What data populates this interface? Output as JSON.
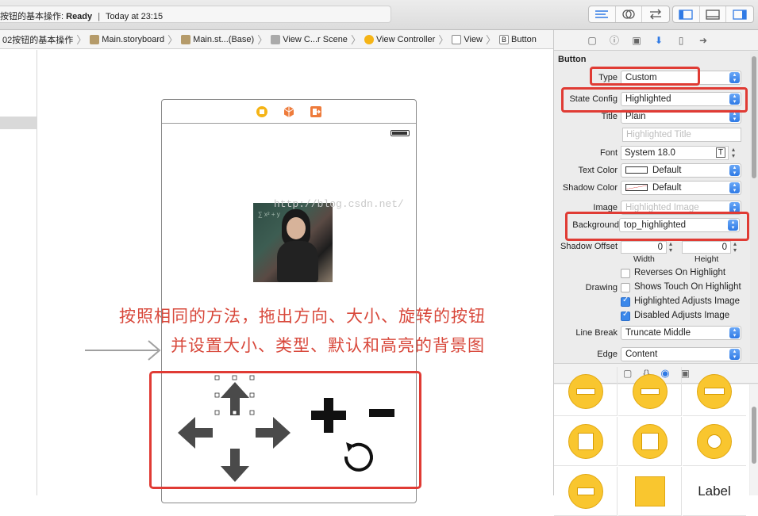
{
  "toolbar": {
    "status_project": "按钮的基本操作:",
    "status_state": "Ready",
    "status_sep": "|",
    "status_time": "Today at 23:15"
  },
  "jumpbar": {
    "crumbs": [
      "02按钮的基本操作",
      "Main.storyboard",
      "Main.st...(Base)",
      "View C...r Scene",
      "View Controller",
      "View",
      "Button"
    ]
  },
  "canvas": {
    "watermark": "http://blog.csdn.net/",
    "annotation_line1": "按照相同的方法，拖出方向、大小、旋转的按钮",
    "annotation_line2": "并设置大小、类型、默认和高亮的背景图",
    "buttons": [
      "arrow-up",
      "arrow-left",
      "arrow-right",
      "arrow-down",
      "plus",
      "minus",
      "rotate"
    ]
  },
  "inspector": {
    "section_title": "Button",
    "type_label": "Type",
    "type_value": "Custom",
    "state_label": "State Config",
    "state_value": "Highlighted",
    "title_label": "Title",
    "title_value": "Plain",
    "title_placeholder": "Highlighted Title",
    "font_label": "Font",
    "font_value": "System 18.0",
    "textcolor_label": "Text Color",
    "textcolor_value": "Default",
    "shadowcolor_label": "Shadow Color",
    "shadowcolor_value": "Default",
    "image_label": "Image",
    "image_placeholder": "Highlighted Image",
    "background_label": "Background",
    "background_value": "top_highlighted",
    "shadowoffset_label": "Shadow Offset",
    "shadow_width": "0",
    "shadow_height": "0",
    "width_caption": "Width",
    "height_caption": "Height",
    "reverses_label": "Reverses On Highlight",
    "drawing_label": "Drawing",
    "shows_touch_label": "Shows Touch On Highlight",
    "adjusts_image_label": "Highlighted Adjusts Image",
    "disabled_adjusts_label": "Disabled Adjusts Image",
    "linebreak_label": "Line Break",
    "linebreak_value": "Truncate Middle",
    "edge_label": "Edge",
    "edge_value": "Content",
    "checks": {
      "reverses": false,
      "shows_touch": false,
      "adjusts_image": true,
      "disabled_adjusts": true
    }
  },
  "library": {
    "label_item": "Label"
  },
  "colors": {
    "annotation_red": "#d8483b",
    "box_red": "#e03b34",
    "accent_blue": "#2f7ae5",
    "library_yellow": "#f9c62f"
  }
}
